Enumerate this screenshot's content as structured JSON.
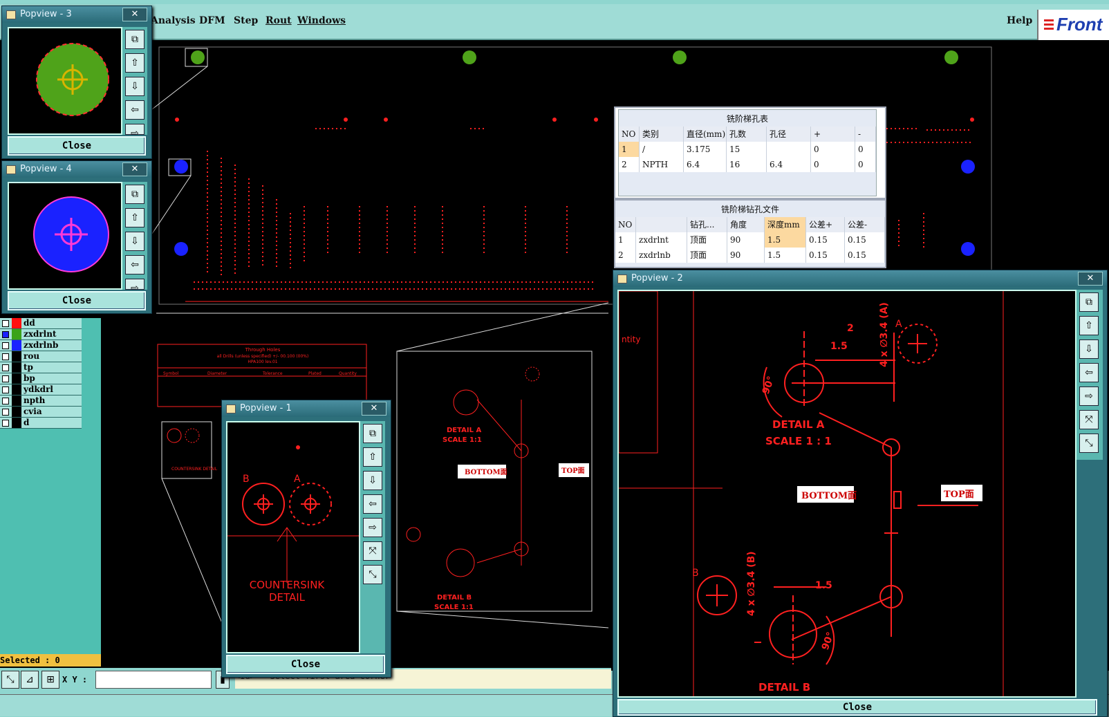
{
  "menu": {
    "items": [
      "Analysis",
      "DFM",
      "Step",
      "Rout",
      "Windows"
    ],
    "help": "Help",
    "logo": "Front"
  },
  "layers": [
    {
      "name": "dd",
      "color": "#ff1010"
    },
    {
      "name": "zxdrlnt",
      "color": "#3aa31a"
    },
    {
      "name": "zxdrlnb",
      "color": "#1a22ff"
    },
    {
      "name": "rou",
      "color": "#000000"
    },
    {
      "name": "tp",
      "color": "#000000"
    },
    {
      "name": "bp",
      "color": "#000000"
    },
    {
      "name": "ydkdrl",
      "color": "#000000"
    },
    {
      "name": "npth",
      "color": "#000000"
    },
    {
      "name": "cvia",
      "color": "#000000"
    },
    {
      "name": "d",
      "color": "#000000"
    }
  ],
  "selected_label": "Selected : 0",
  "bottombar": {
    "xy_label": "X Y :",
    "command_text": "<Id> - Select first area corner"
  },
  "popups": {
    "p3": {
      "title": "Popview - 3",
      "close": "Close"
    },
    "p4": {
      "title": "Popview - 4",
      "close": "Close"
    },
    "p1": {
      "title": "Popview - 1",
      "close": "Close",
      "text_countersink": "COUNTERSINK",
      "text_detail": "DETAIL",
      "label_a": "A",
      "label_b": "B"
    },
    "p2": {
      "title": "Popview - 2",
      "close": "Close",
      "detail_a": "DETAIL A",
      "scale_a": "SCALE 1 : 1",
      "detail_b": "DETAIL B",
      "bottom_label": "BOTTOM面",
      "top_label": "TOP面",
      "dim_2": "2",
      "dim_15a": "1.5",
      "dim_15b": "1.5",
      "dim_90a": "90°",
      "dim_90b": "90°",
      "dia_a": "4 x ∅3.4 (A)",
      "dia_b": "4 x ∅3.4 (B)",
      "label_a": "A",
      "label_b": "B",
      "partial_text": "ntity"
    }
  },
  "table1": {
    "caption": "铣阶梯孔表",
    "headers": [
      "NO",
      "类别",
      "直径(mm)",
      "孔数",
      "孔径",
      "+",
      "-"
    ],
    "rows": [
      [
        "1",
        "/",
        "3.175",
        "15",
        "",
        "0",
        "0"
      ],
      [
        "2",
        "NPTH",
        "6.4",
        "16",
        "6.4",
        "0",
        "0"
      ]
    ]
  },
  "table2": {
    "caption": "铣阶梯钻孔文件",
    "headers": [
      "NO",
      "",
      "钻孔...",
      "角度",
      "深度mm",
      "公差+",
      "公差-"
    ],
    "rows": [
      [
        "1",
        "zxdrlnt",
        "顶面",
        "90",
        "1.5",
        "0.15",
        "0.15"
      ],
      [
        "2",
        "zxdrlnb",
        "顶面",
        "90",
        "1.5",
        "0.15",
        "0.15"
      ]
    ]
  },
  "canvas_drawing": {
    "detail_a": "DETAIL A",
    "scale_a": "SCALE 1:1",
    "detail_b": "DETAIL B",
    "scale_b": "SCALE 1:1",
    "bottom_label": "BOTTOM面",
    "top_label": "TOP面",
    "through_holes": "Through Holes",
    "through_holes_note": "all Drills (unless specified) +/- 00.100 (00%)",
    "ipc": "HPA100 lev.01",
    "columns": [
      "Symbol",
      "Diameter",
      "Tolerance",
      "Plated",
      "Quantity"
    ],
    "countersink": "COUNTERSINK DETAIL"
  },
  "colors": {
    "drawing_red": "#ff2020",
    "pad_green": "#4fa31a",
    "pad_blue": "#1a22ff",
    "ring_red": "#ff3030",
    "magenta": "#ff3ad6"
  }
}
